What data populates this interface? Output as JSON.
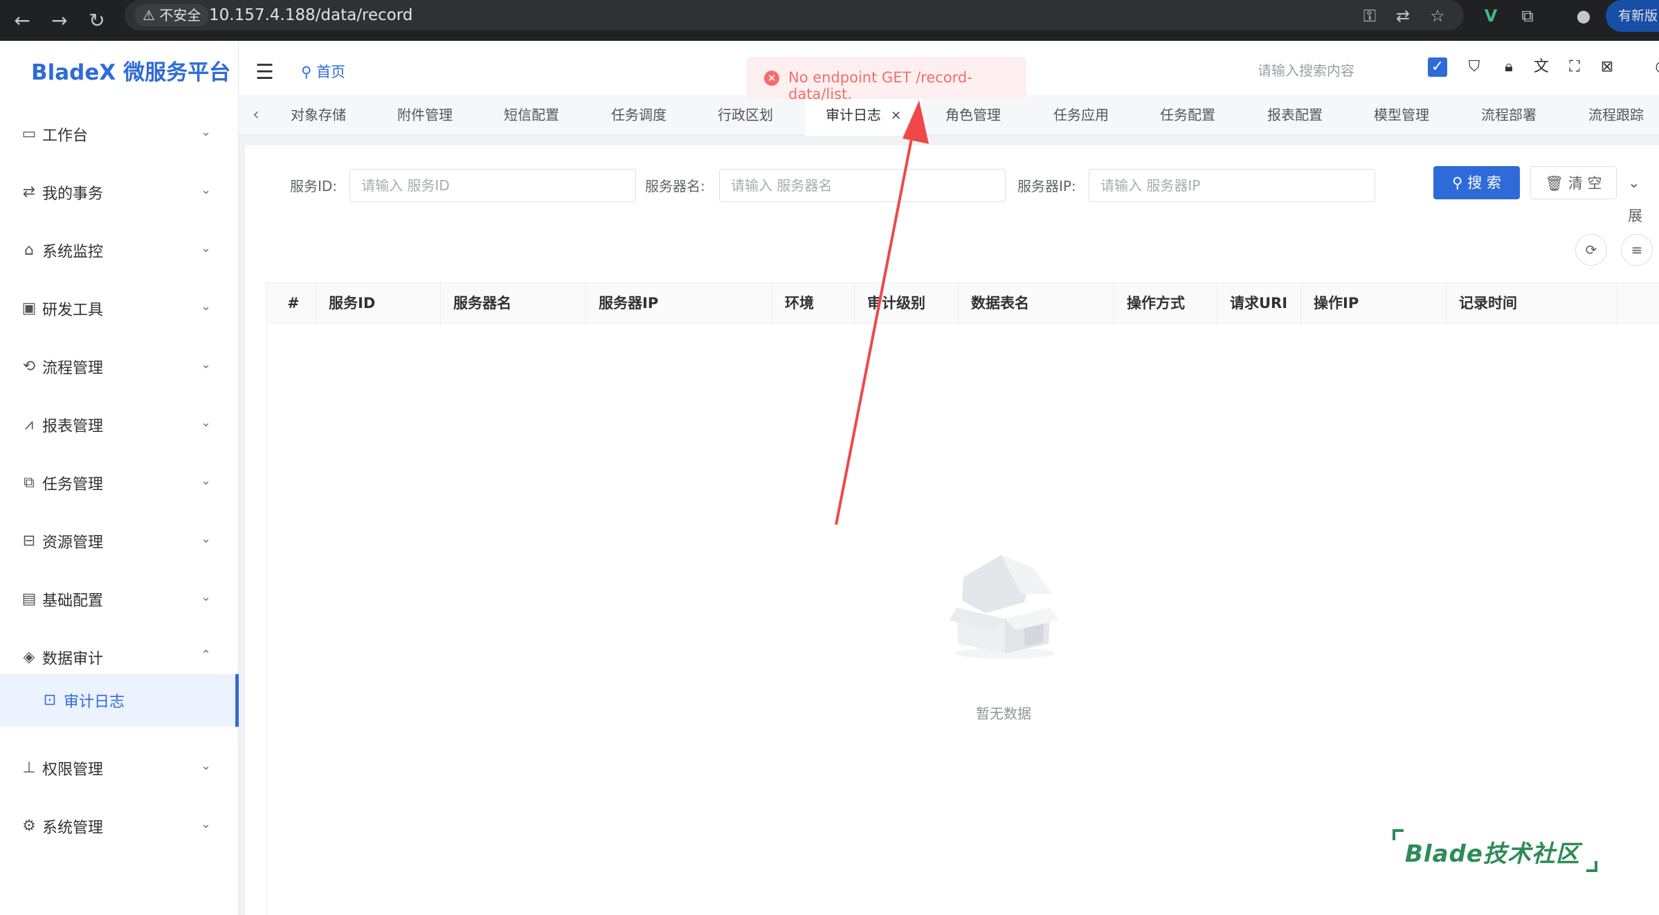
{
  "browser": {
    "back": "←",
    "forward": "→",
    "reload": "↻",
    "security_label": "⚠ 不安全",
    "url": "10.157.4.188/data/record",
    "update_label": "有新版"
  },
  "app": {
    "title": "BladeX 微服务平台",
    "breadcrumb": "首页",
    "search_placeholder": "请输入搜索内容",
    "accent_color": "#2f6bd8"
  },
  "sidebar": {
    "items": [
      {
        "label": "工作台",
        "icon": "monitor-icon"
      },
      {
        "label": "我的事务",
        "icon": "transfer-icon"
      },
      {
        "label": "系统监控",
        "icon": "alarm-icon"
      },
      {
        "label": "研发工具",
        "icon": "code-icon"
      },
      {
        "label": "流程管理",
        "icon": "flow-icon"
      },
      {
        "label": "报表管理",
        "icon": "chart-icon"
      },
      {
        "label": "任务管理",
        "icon": "tasks-icon"
      },
      {
        "label": "资源管理",
        "icon": "resource-icon"
      },
      {
        "label": "基础配置",
        "icon": "config-icon"
      },
      {
        "label": "数据审计",
        "icon": "layers-icon",
        "expanded": true
      },
      {
        "label": "审计日志",
        "icon": "audit-icon",
        "active": true
      },
      {
        "label": "权限管理",
        "icon": "stamp-icon"
      },
      {
        "label": "系统管理",
        "icon": "gear-icon"
      }
    ]
  },
  "tags": [
    {
      "label": "对象存储"
    },
    {
      "label": "附件管理"
    },
    {
      "label": "短信配置"
    },
    {
      "label": "任务调度"
    },
    {
      "label": "行政区划"
    },
    {
      "label": "审计日志",
      "active": true
    },
    {
      "label": "角色管理"
    },
    {
      "label": "任务应用"
    },
    {
      "label": "任务配置"
    },
    {
      "label": "报表配置"
    },
    {
      "label": "模型管理"
    },
    {
      "label": "流程部署"
    },
    {
      "label": "流程跟踪"
    }
  ],
  "toast": {
    "message": "No endpoint GET /record-data/list.",
    "type": "error",
    "color": "#f56c6c"
  },
  "filters": {
    "service_id_label": "服务ID:",
    "service_id_placeholder": "请输入 服务ID",
    "server_name_label": "服务器名:",
    "server_name_placeholder": "请输入 服务器名",
    "server_ip_label": "服务器IP:",
    "server_ip_placeholder": "请输入 服务器IP",
    "search_label": "搜 索",
    "clear_label": "清 空",
    "expand_label": "展"
  },
  "table": {
    "columns": [
      "#",
      "服务ID",
      "服务器名",
      "服务器IP",
      "环境",
      "审计级别",
      "数据表名",
      "操作方式",
      "请求URI",
      "操作IP",
      "记录时间"
    ],
    "rows": [],
    "empty_text": "暂无数据"
  },
  "watermark": "Blade技术社区"
}
